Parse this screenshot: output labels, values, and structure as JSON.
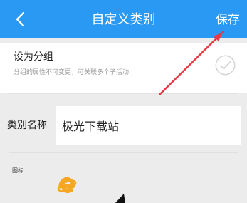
{
  "header": {
    "title": "自定义类别",
    "save_label": "保存",
    "back_icon": "chevron-left-icon"
  },
  "group_setting": {
    "title": "设为分组",
    "description": "分组的属性不可变更，可关联多个子活动",
    "check_icon": "check-circle-icon"
  },
  "category": {
    "label": "类别名称",
    "value": "极光下载站"
  },
  "icon_section": {
    "label": "图标",
    "selected_icon": "ie-icon"
  },
  "colors": {
    "header": "#2a99f3",
    "annotation": "#e63946",
    "icon_orange": "#f5a623"
  }
}
